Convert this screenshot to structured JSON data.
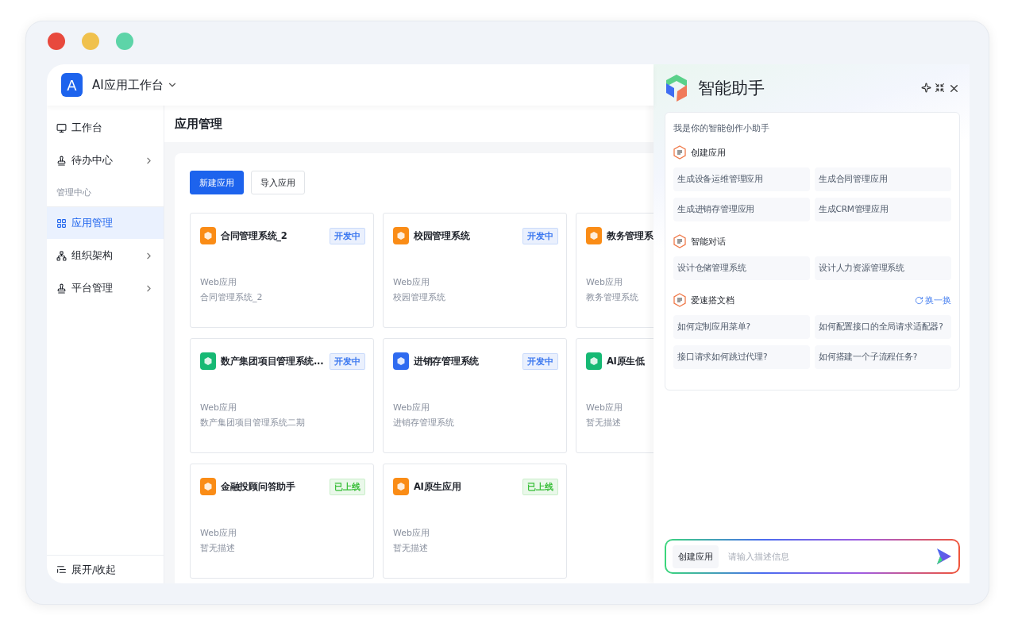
{
  "app": {
    "logo_letter": "A",
    "title": "AI应用工作台"
  },
  "sidebar": {
    "items": [
      {
        "kind": "item",
        "label": "工作台",
        "has_children": false,
        "selected": false
      },
      {
        "kind": "item",
        "label": "待办中心",
        "has_children": true,
        "selected": false
      },
      {
        "kind": "section",
        "label": "管理中心"
      },
      {
        "kind": "item",
        "label": "应用管理",
        "has_children": false,
        "selected": true
      },
      {
        "kind": "item",
        "label": "组织架构",
        "has_children": true,
        "selected": false
      },
      {
        "kind": "item",
        "label": "平台管理",
        "has_children": true,
        "selected": false
      }
    ],
    "footer": "展开/收起"
  },
  "page": {
    "title": "应用管理",
    "buttons": [
      {
        "label": "新建应用",
        "kind": "primary"
      },
      {
        "label": "导入应用",
        "kind": "default"
      }
    ],
    "cards": [
      {
        "name": "合同管理系统_2",
        "color": "#fa8c16",
        "status": {
          "text": "开发中",
          "color": "#3c78f0"
        },
        "type": "Web应用",
        "description": "合同管理系统_2"
      },
      {
        "name": "校园管理系统",
        "color": "#fa8c16",
        "status": {
          "text": "开发中",
          "color": "#3c78f0"
        },
        "type": "Web应用",
        "description": "校园管理系统"
      },
      {
        "name": "教务管理系",
        "color": "#fa8c16",
        "type": "Web应用",
        "description": "教务管理系统"
      },
      {
        "name": "数产集团项目管理系统...",
        "color": "#16b974",
        "status": {
          "text": "开发中",
          "color": "#3c78f0"
        },
        "type": "Web应用",
        "description": "数产集团项目管理系统二期"
      },
      {
        "name": "进销存管理系统",
        "color": "#2f6bf0",
        "status": {
          "text": "开发中",
          "color": "#3c78f0"
        },
        "type": "Web应用",
        "description": "进销存管理系统"
      },
      {
        "name": "AI原生低",
        "color": "#16b974",
        "type": "Web应用",
        "description": "暂无描述"
      },
      {
        "name": "金融投顾问答助手",
        "color": "#fa8c16",
        "status": {
          "text": "已上线",
          "color": "#3cbf3c"
        },
        "type": "Web应用",
        "description": "暂无描述"
      },
      {
        "name": "AI原生应用",
        "color": "#fa8c16",
        "status": {
          "text": "已上线",
          "color": "#3cbf3c"
        },
        "type": "Web应用",
        "description": "暂无描述"
      }
    ]
  },
  "assistant": {
    "title": "智能助手",
    "greeting": "我是你的智能创作小助手",
    "sections": [
      {
        "title": "创建应用",
        "suggestions": [
          "生成设备运维管理应用",
          "生成合同管理应用",
          "生成进销存管理应用",
          "生成CRM管理应用"
        ]
      },
      {
        "title": "智能对话",
        "suggestions": [
          "设计仓储管理系统",
          "设计人力资源管理系统"
        ]
      },
      {
        "title": "爱速搭文档",
        "action": "换一换",
        "suggestions": [
          "如何定制应用菜单?",
          "如何配置接口的全局请求适配器?",
          "接口请求如何跳过代理?",
          "如何搭建一个子流程任务?"
        ]
      }
    ],
    "input": {
      "chip": "创建应用",
      "placeholder": "请输入描述信息"
    }
  }
}
